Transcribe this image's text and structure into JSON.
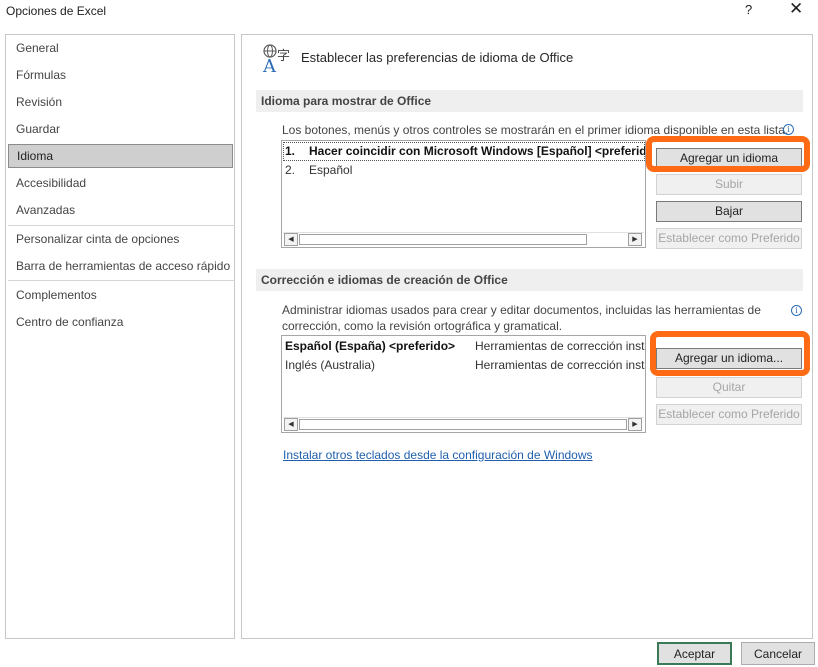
{
  "window": {
    "title": "Opciones de Excel",
    "help": "?",
    "close": "✕"
  },
  "sidebar": {
    "items": [
      {
        "label": "General",
        "selected": false
      },
      {
        "label": "Fórmulas",
        "selected": false
      },
      {
        "label": "Revisión",
        "selected": false
      },
      {
        "label": "Guardar",
        "selected": false
      },
      {
        "label": "Idioma",
        "selected": true
      },
      {
        "label": "Accesibilidad",
        "selected": false
      },
      {
        "label": "Avanzadas",
        "selected": false
      },
      {
        "label": "Personalizar cinta de opciones",
        "selected": false
      },
      {
        "label": "Barra de herramientas de acceso rápido",
        "selected": false
      },
      {
        "label": "Complementos",
        "selected": false
      },
      {
        "label": "Centro de confianza",
        "selected": false
      }
    ]
  },
  "main": {
    "header": {
      "icon": "language-icon",
      "title": "Establecer las preferencias de idioma de Office"
    },
    "display": {
      "heading": "Idioma para mostrar de Office",
      "description": "Los botones, menús y otros controles se mostrarán en el primer idioma disponible en esta lista.",
      "languages": [
        {
          "num": "1.",
          "name": "Hacer coincidir con Microsoft Windows [Español] <preferido>"
        },
        {
          "num": "2.",
          "name": "Español"
        }
      ],
      "buttons": {
        "add": "Agregar un idioma",
        "up": "Subir",
        "down": "Bajar",
        "set_preferred": "Establecer como Preferido"
      }
    },
    "authoring": {
      "heading": "Corrección e idiomas de creación de Office",
      "description_line1": "Administrar idiomas usados para crear y editar documentos, incluidas las herramientas de",
      "description_line2": "corrección, como la revisión ortográfica y gramatical.",
      "languages": [
        {
          "name": "Español (España) <preferido>",
          "tools": "Herramientas de corrección instaladas"
        },
        {
          "name": "Inglés (Australia)",
          "tools": "Herramientas de corrección instaladas"
        }
      ],
      "buttons": {
        "add": "Agregar un idioma...",
        "remove": "Quitar",
        "set_preferred": "Establecer como Preferido"
      }
    },
    "link": "Instalar otros teclados desde la configuración de Windows"
  },
  "footer": {
    "ok": "Aceptar",
    "cancel": "Cancelar"
  },
  "colors": {
    "annotation": "#ff6a14",
    "link": "#1f5fad",
    "accent_ok_border": "#3b7a57"
  }
}
